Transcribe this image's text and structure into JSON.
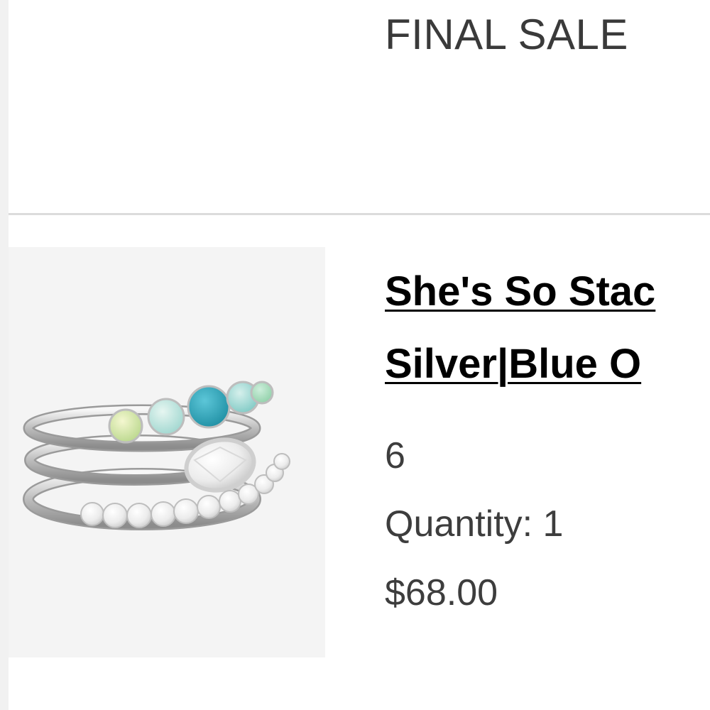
{
  "header": {
    "final_sale_label": "FINAL SALE"
  },
  "cart_item": {
    "title_line_1": "She's So Stac",
    "title_line_2": "Silver|Blue O",
    "size": "6",
    "quantity_label": "Quantity: 1",
    "price": "$68.00",
    "image_alt": "Stacked ring set: opal band, oval white stone band, eternity band",
    "opal_colors": [
      "#b9d78c",
      "#9fd6cf",
      "#1f9fb0",
      "#7ec9c4",
      "#8fd0a8"
    ]
  }
}
